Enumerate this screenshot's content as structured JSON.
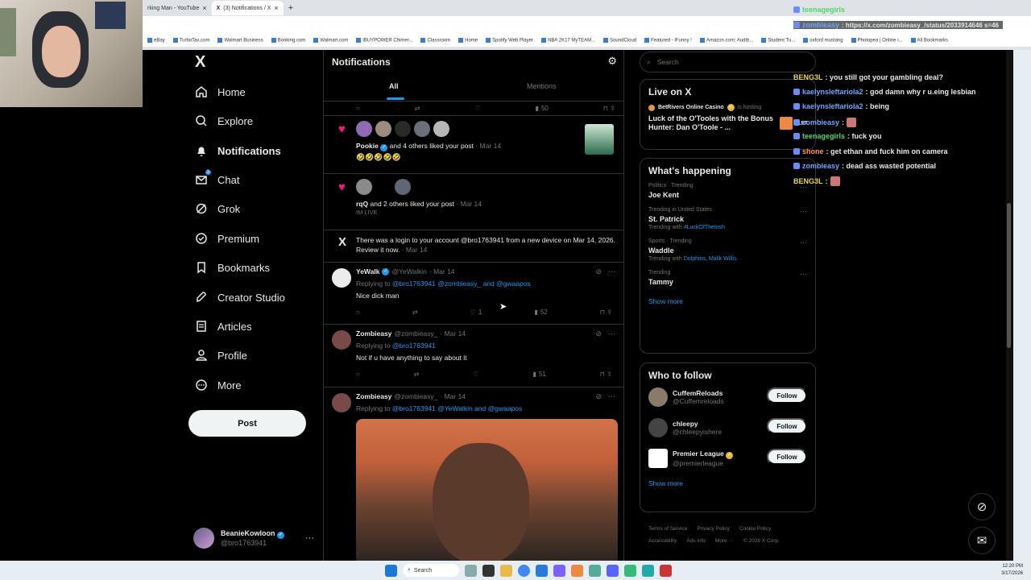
{
  "browser": {
    "tabs": [
      {
        "label": "rking Man - YouTube"
      },
      {
        "label": "(3) Notifications / X",
        "active": true
      }
    ],
    "bookmarks": [
      "eBay",
      "TurboTax.com",
      "Walmart Business",
      "Booking.com",
      "Walmart.com",
      "iBUYPOWER Chimer...",
      "Classroom",
      "Home",
      "Spotify Web Player",
      "NBA 2K17 MyTEAM...",
      "SoundCloud",
      "Featured - iFunny !",
      "Amazon.com: Audib...",
      "Student Tu...",
      "oxford mustang",
      "Photopea | Online i...",
      "All Bookmarks"
    ]
  },
  "sidebar": {
    "logo": "X",
    "items": [
      {
        "label": "Home",
        "icon": "home-icon"
      },
      {
        "label": "Explore",
        "icon": "search-icon"
      },
      {
        "label": "Notifications",
        "icon": "bell-icon",
        "active": true
      },
      {
        "label": "Chat",
        "icon": "mail-icon",
        "badge": "3"
      },
      {
        "label": "Grok",
        "icon": "grok-icon"
      },
      {
        "label": "Premium",
        "icon": "premium-icon"
      },
      {
        "label": "Bookmarks",
        "icon": "bookmark-icon"
      },
      {
        "label": "Creator Studio",
        "icon": "rocket-icon"
      },
      {
        "label": "Articles",
        "icon": "articles-icon"
      },
      {
        "label": "Profile",
        "icon": "person-icon"
      },
      {
        "label": "More",
        "icon": "more-icon"
      }
    ],
    "post_label": "Post",
    "account": {
      "name": "BeanieKowloon",
      "handle": "@bro1763941"
    }
  },
  "main": {
    "title": "Notifications",
    "tabs": {
      "all": "All",
      "mentions": "Mentions"
    },
    "top_actions": {
      "views": "50"
    },
    "likes": [
      {
        "user": "Pookie",
        "text": " and 4 others liked your post",
        "date": "· Mar 14",
        "extra": "🤣🤣🤣🤣🤣"
      },
      {
        "user": "rqQ",
        "text": " and 2 others liked your post",
        "date": "· Mar 14",
        "extra": "IM LIVE"
      }
    ],
    "login_notice": {
      "text": "There was a login to your account @bro1763941 from a new device on Mar 14, 2026. Review it now.",
      "date": "· Mar 14"
    },
    "tweets": [
      {
        "name": "YeWalk",
        "handle": "@YeWalkin",
        "date": "· Mar 14",
        "replying": "Replying to ",
        "reply_to": "@bro1763941 @zombieasy_ and @gwaapos",
        "body": "Nice dick man",
        "likes": "1",
        "views": "52"
      },
      {
        "name": "Zombieasy",
        "handle": "@zombieasy_",
        "date": "· Mar 14",
        "replying": "Replying to ",
        "reply_to": "@bro1763941",
        "body": "Not if u have anything to say about it",
        "likes": "",
        "views": "51"
      },
      {
        "name": "Zombieasy",
        "handle": "@zombieasy_",
        "date": "· Mar 14",
        "replying": "Replying to ",
        "reply_to": "@bro1763941 @YeWalkin and @gwaapos"
      }
    ]
  },
  "right": {
    "search_placeholder": "Search",
    "live": {
      "title": "Live on X",
      "host": "BetRivers Online Casino",
      "hosting": "is hosting",
      "stream_title": "Luck of the O'Tooles with the Bonus Hunter: Dan O'Toole - ...",
      "count": "+187"
    },
    "happening": {
      "title": "What's happening",
      "trends": [
        {
          "ctx": "Politics · Trending",
          "name": "Joe Kent",
          "with_label": "",
          "with": ""
        },
        {
          "ctx": "Trending in United States",
          "name": "St. Patrick",
          "with_label": "Trending with ",
          "with": "#LuckOfTheIrish"
        },
        {
          "ctx": "Sports · Trending",
          "name": "Waddle",
          "with_label": "Trending with ",
          "with": "Dolphins, Malik Willis"
        },
        {
          "ctx": "Trending",
          "name": "Tammy",
          "with_label": "",
          "with": ""
        }
      ],
      "show_more": "Show more"
    },
    "who_to_follow": {
      "title": "Who to follow",
      "users": [
        {
          "name": "CuffemReloads",
          "handle": "@Cuffemreloads"
        },
        {
          "name": "chleepy",
          "handle": "@chleepyishere"
        },
        {
          "name": "Premier League",
          "handle": "@premierleague"
        }
      ],
      "follow_label": "Follow",
      "show_more": "Show more"
    },
    "footer": [
      "Terms of Service",
      "Privacy Policy",
      "Cookie Policy",
      "Accessibility",
      "Ads info",
      "More ···",
      "© 2026 X Corp."
    ]
  },
  "chat": [
    {
      "user": "teenagegirls",
      "color": "green",
      "msg": ""
    },
    {
      "user": "zombieasy",
      "color": "blue",
      "msg": ": https://x.com/zombieasy_/status/2033914646 s=46"
    },
    {
      "user": "BENG3L",
      "color": "yellow",
      "msg": ": you still got your gambling deal?"
    },
    {
      "user": "kaelynsleftariola2",
      "color": "blue",
      "msg": ": god damn why r u.eing lesbian"
    },
    {
      "user": "kaelynsleftariola2",
      "color": "blue",
      "msg": ": being"
    },
    {
      "user": "zombieasy",
      "color": "blue",
      "msg": ":"
    },
    {
      "user": "teenagegirls",
      "color": "green",
      "msg": ": fuck you"
    },
    {
      "user": "shone",
      "color": "orange",
      "msg": ": get ethan and fuck him on camera"
    },
    {
      "user": "zombieasy",
      "color": "blue",
      "msg": ": dead ass wasted potential"
    },
    {
      "user": "BENG3L",
      "color": "yellow",
      "msg": ":"
    }
  ],
  "taskbar": {
    "search": "Search",
    "time": "12:20 PM",
    "date": "3/17/2026"
  }
}
